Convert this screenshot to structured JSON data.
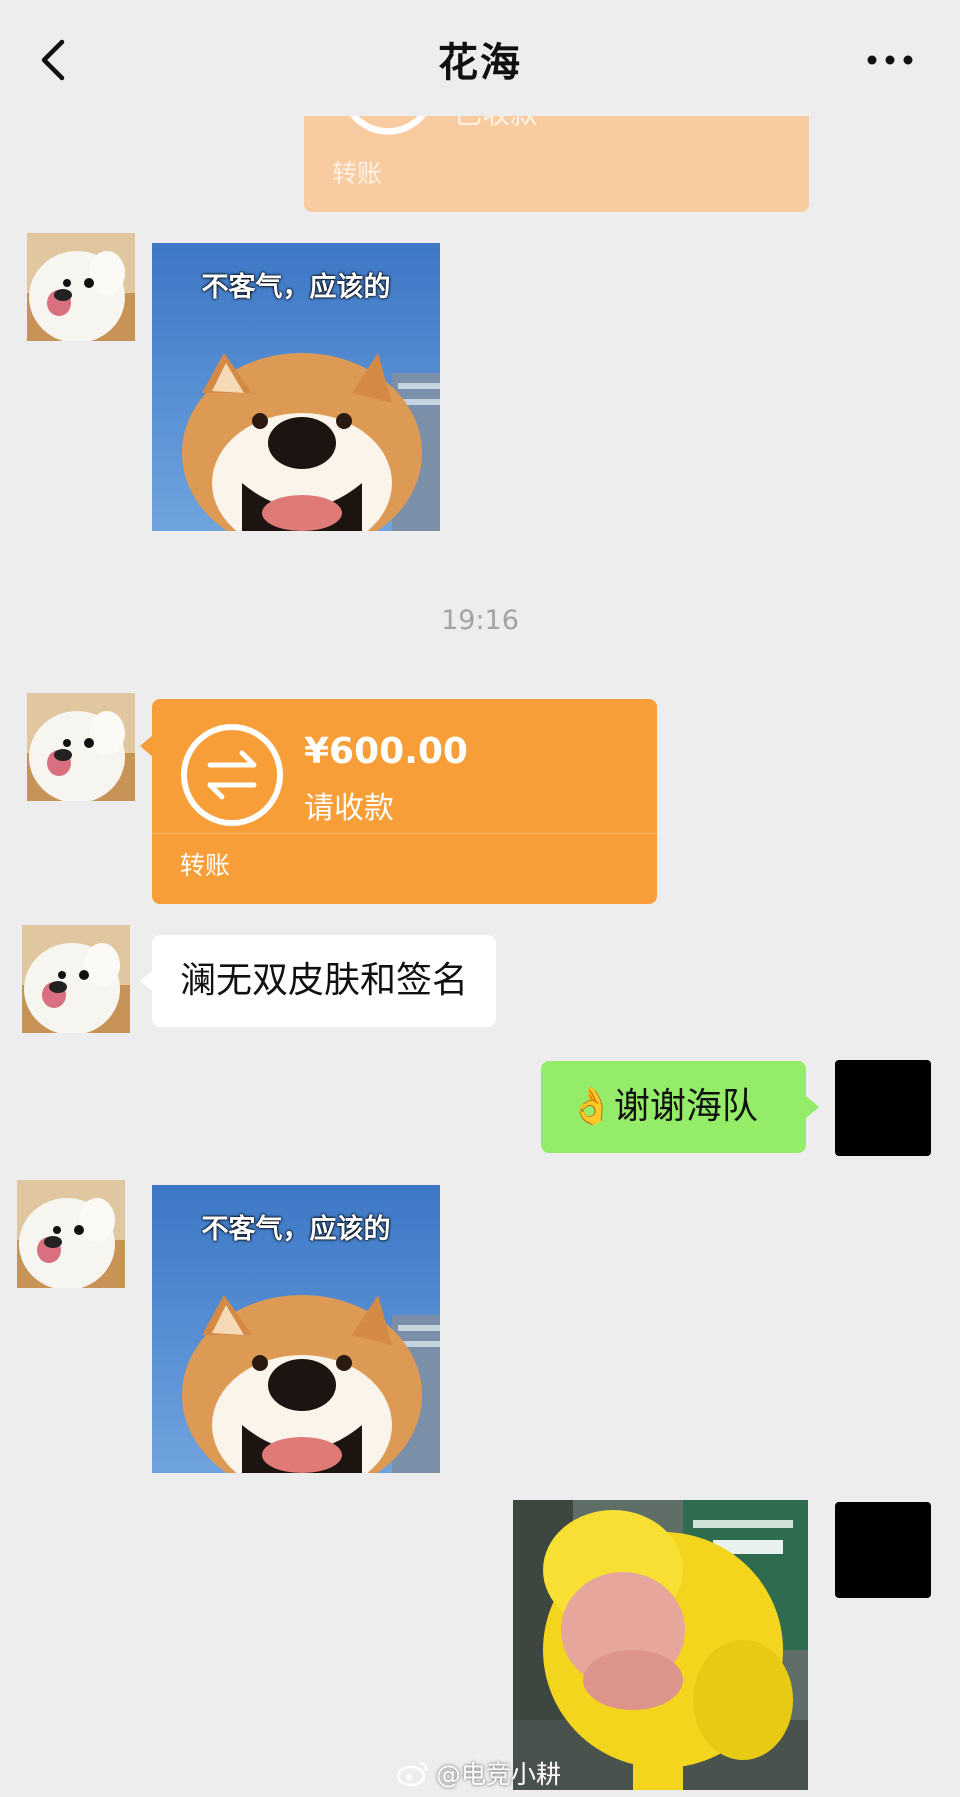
{
  "header": {
    "title": "花海",
    "back_icon": "chevron-left-icon",
    "more_icon": "more-dots-icon"
  },
  "messages": {
    "top_transfer": {
      "label": "转账",
      "note": "已收款"
    },
    "sticker1_caption": "不客气，应该的",
    "timestamp": "19:16",
    "transfer": {
      "amount": "¥600.00",
      "note": "请收款",
      "label": "转账"
    },
    "text_left": "澜无双皮肤和签名",
    "text_right_emoji": "👌",
    "text_right": "谢谢海队",
    "sticker2_caption": "不客气，应该的"
  },
  "watermark": {
    "text": "@电竞小耕",
    "icon": "weibo-icon"
  },
  "colors": {
    "background": "#ededed",
    "transfer": "#f79e39",
    "transfer_received": "#f8cba0",
    "bubble_mine": "#95ec69",
    "bubble_other": "#ffffff"
  }
}
